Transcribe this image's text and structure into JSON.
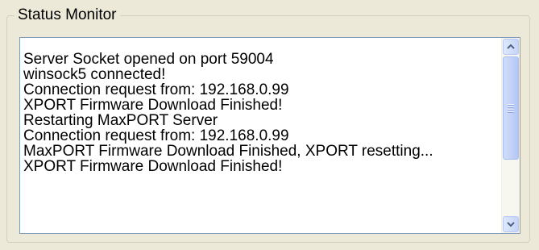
{
  "status_monitor": {
    "title": "Status Monitor",
    "log_lines": [
      "Server Socket opened on port 59004",
      "winsock5 connected!",
      "Connection request from: 192.168.0.99",
      "XPORT Firmware Download Finished!",
      "Restarting MaxPORT Server",
      "Connection request from: 192.168.0.99",
      "MaxPORT Firmware Download Finished, XPORT resetting...",
      "XPORT Firmware Download Finished!"
    ],
    "scrollbar": {
      "up_icon": "chevron-up-icon",
      "down_icon": "chevron-down-icon"
    }
  }
}
